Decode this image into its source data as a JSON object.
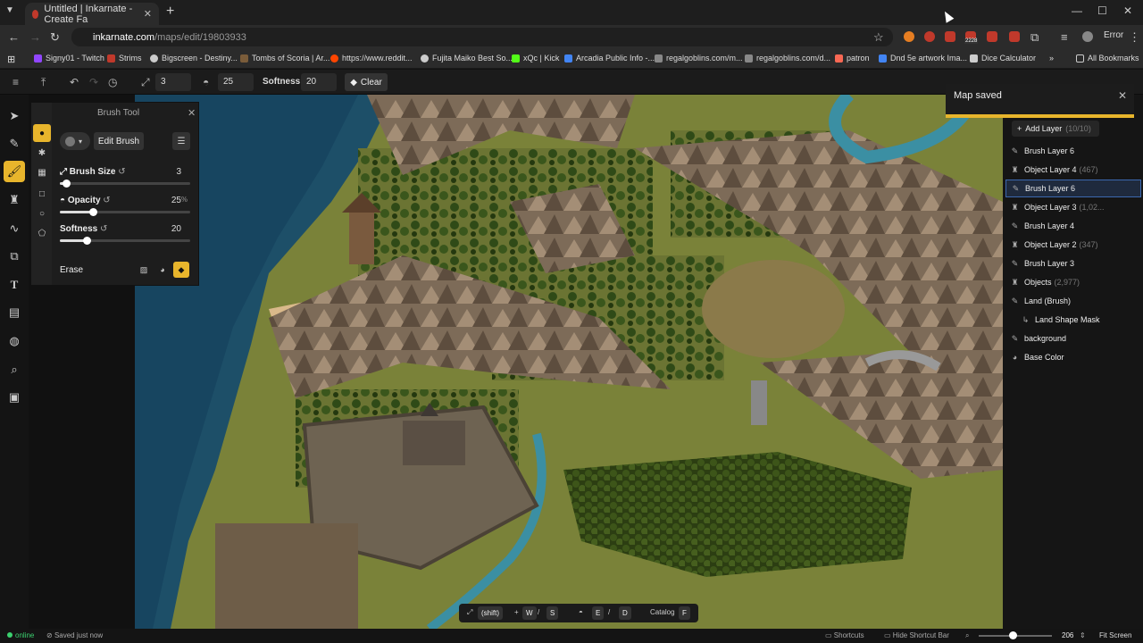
{
  "browser": {
    "tab_title": "Untitled | Inkarnate - Create Fa",
    "url_host": "inkarnate.com",
    "url_path": "/maps/edit/19803933",
    "profile_label": "Error",
    "ext_badge": "2228",
    "bookmarks": [
      {
        "label": "Signy01 - Twitch",
        "color": "#9146ff"
      },
      {
        "label": "Strims",
        "color": "#c0392b"
      },
      {
        "label": "Bigscreen - Destiny...",
        "color": "#cccccc"
      },
      {
        "label": "Tombs of Scoria | Ar...",
        "color": "#7a5c3a"
      },
      {
        "label": "https://www.reddit...",
        "color": "#ff4500"
      },
      {
        "label": "Fujita Maiko Best So...",
        "color": "#cccccc"
      },
      {
        "label": "xQc | Kick",
        "color": "#53fc18"
      },
      {
        "label": "Arcadia Public Info -...",
        "color": "#4285f4"
      },
      {
        "label": "regalgoblins.com/m...",
        "color": "#888888"
      },
      {
        "label": "regalgoblins.com/d...",
        "color": "#888888"
      },
      {
        "label": "patron",
        "color": "#f96854"
      },
      {
        "label": "Dnd 5e artwork Ima...",
        "color": "#4285f4"
      },
      {
        "label": "Dice Calculator",
        "color": "#cccccc"
      }
    ],
    "all_bookmarks": "All Bookmarks"
  },
  "toolbar": {
    "size_value": "3",
    "opacity_value": "25",
    "softness_label": "Softness:",
    "softness_value": "20",
    "clear_label": "Clear"
  },
  "brush_panel": {
    "title": "Brush Tool",
    "edit_brush": "Edit Brush",
    "brush_size_label": "Brush Size",
    "brush_size_value": "3",
    "opacity_label": "Opacity",
    "opacity_value": "25",
    "opacity_unit": "%",
    "softness_label": "Softness",
    "softness_value": "20",
    "erase_label": "Erase"
  },
  "toast": {
    "message": "Map saved"
  },
  "layers": {
    "add_label": "Add Layer",
    "add_count": "(10/10)",
    "items": [
      {
        "label": "Brush Layer 6",
        "icon": "brush",
        "count": ""
      },
      {
        "label": "Object Layer 4",
        "icon": "object",
        "count": "(467)"
      },
      {
        "label": "Brush Layer 6",
        "icon": "brush",
        "count": ""
      },
      {
        "label": "Object Layer 3",
        "icon": "object",
        "count": "(1,02..."
      },
      {
        "label": "Brush Layer 4",
        "icon": "brush",
        "count": ""
      },
      {
        "label": "Object Layer 2",
        "icon": "object",
        "count": "(347)"
      },
      {
        "label": "Brush Layer 3",
        "icon": "brush",
        "count": ""
      },
      {
        "label": "Objects",
        "icon": "object",
        "count": "(2,977)"
      },
      {
        "label": "Land (Brush)",
        "icon": "brush",
        "count": ""
      },
      {
        "label": "Land Shape Mask",
        "icon": "mask",
        "count": ""
      },
      {
        "label": "background",
        "icon": "brush",
        "count": ""
      },
      {
        "label": "Base Color",
        "icon": "palette",
        "count": ""
      }
    ],
    "selected_index": 2
  },
  "shortcut_bar": {
    "shift": "(shift)",
    "w": "W",
    "s": "S",
    "e": "E",
    "d": "D",
    "catalog": "Catalog",
    "f": "F"
  },
  "status": {
    "online": "online",
    "saved": "Saved just now",
    "shortcuts": "Shortcuts",
    "hide_shortcut_bar": "Hide Shortcut Bar",
    "zoom": "206",
    "fit_screen": "Fit Screen"
  },
  "colors": {
    "accent": "#e8b52c",
    "selected_layer": "#3c68b0",
    "online": "#3bd16f"
  }
}
